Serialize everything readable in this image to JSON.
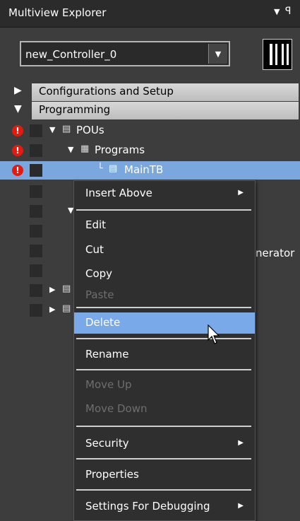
{
  "panel": {
    "title": "Multiview Explorer"
  },
  "controller": {
    "selected": "new_Controller_0"
  },
  "groups": [
    {
      "label": "Configurations and Setup"
    },
    {
      "label": "Programming"
    }
  ],
  "tree": {
    "pous": "POUs",
    "programs": "Programs",
    "maintb": "MainTB",
    "partial_text": "nerator"
  },
  "context_menu": {
    "items": [
      {
        "label": "Insert Above"
      },
      {
        "label": "Edit"
      },
      {
        "label": "Cut"
      },
      {
        "label": "Copy"
      },
      {
        "label": "Paste"
      },
      {
        "label": "Delete"
      },
      {
        "label": "Rename"
      },
      {
        "label": "Move Up"
      },
      {
        "label": "Move Down"
      },
      {
        "label": "Security"
      },
      {
        "label": "Properties"
      },
      {
        "label": "Settings For Debugging"
      }
    ]
  },
  "colors": {
    "selection": "#7aa7dd",
    "menu_highlight": "#79a9e8",
    "error": "#e51a0f"
  }
}
